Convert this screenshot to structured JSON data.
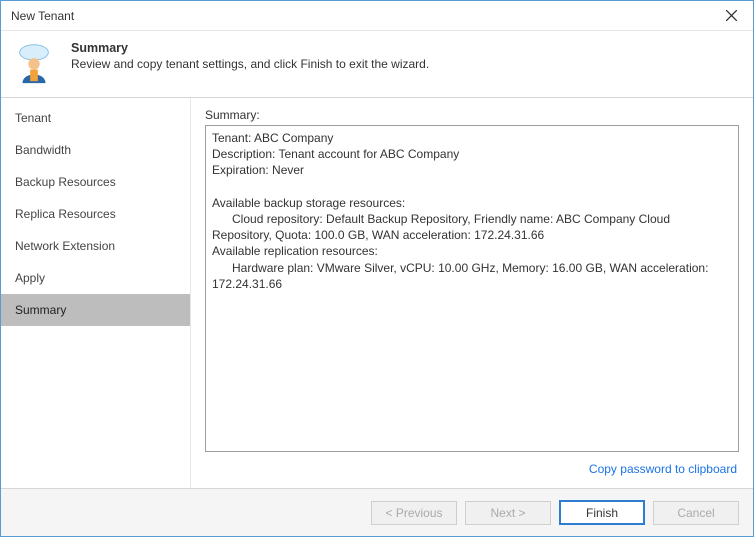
{
  "window": {
    "title": "New Tenant"
  },
  "header": {
    "title": "Summary",
    "subtitle": "Review and copy tenant settings, and click Finish to exit the wizard."
  },
  "sidebar": {
    "items": [
      {
        "label": "Tenant"
      },
      {
        "label": "Bandwidth"
      },
      {
        "label": "Backup Resources"
      },
      {
        "label": "Replica Resources"
      },
      {
        "label": "Network Extension"
      },
      {
        "label": "Apply"
      },
      {
        "label": "Summary",
        "selected": true
      }
    ]
  },
  "content": {
    "summary_label": "Summary:",
    "summary_text": "Tenant: ABC Company\nDescription: Tenant account for ABC Company\nExpiration: Never\n\nAvailable backup storage resources:\n      Cloud repository: Default Backup Repository, Friendly name: ABC Company Cloud Repository, Quota: 100.0 GB, WAN acceleration: 172.24.31.66\nAvailable replication resources:\n      Hardware plan: VMware Silver, vCPU: 10.00 GHz, Memory: 16.00 GB, WAN acceleration: 172.24.31.66",
    "copy_link": "Copy password to clipboard"
  },
  "footer": {
    "previous": "< Previous",
    "next": "Next >",
    "finish": "Finish",
    "cancel": "Cancel"
  }
}
